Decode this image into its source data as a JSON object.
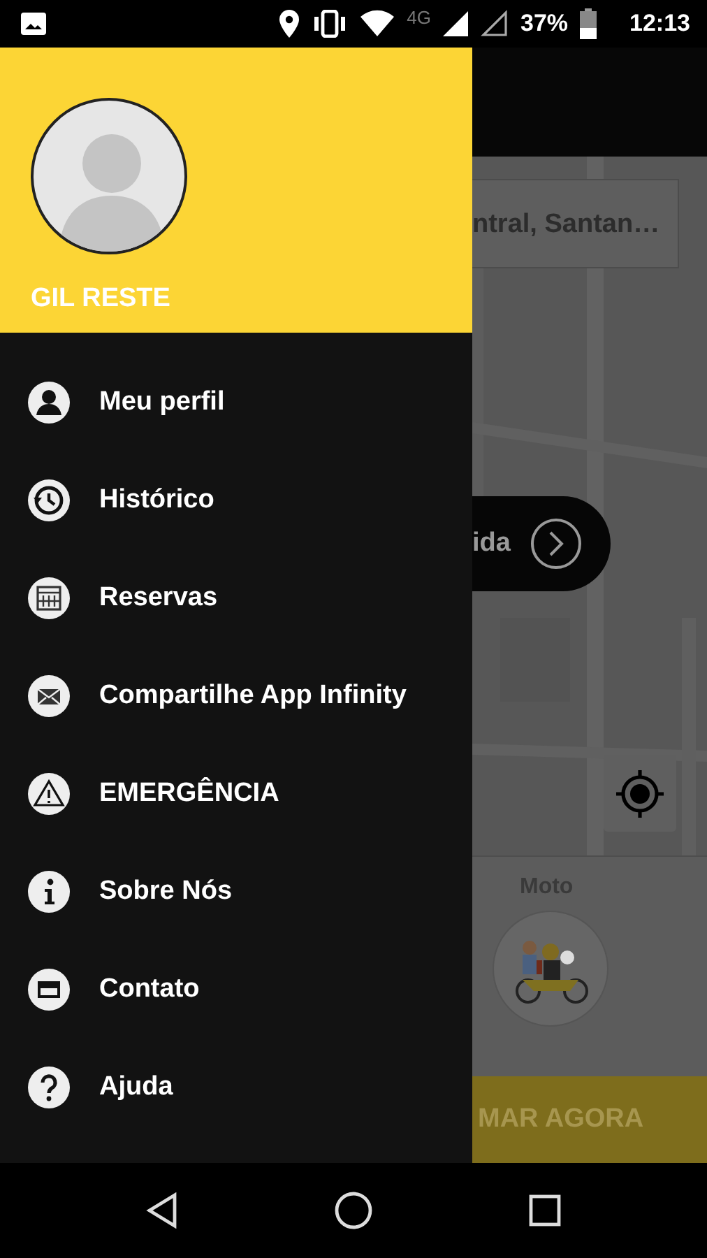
{
  "status_bar": {
    "network": "4G",
    "battery": "37%",
    "time": "12:13"
  },
  "drawer": {
    "user_name": "GIL RESTE",
    "items": [
      {
        "label": "Meu perfil"
      },
      {
        "label": "Histórico"
      },
      {
        "label": "Reservas"
      },
      {
        "label": "Compartilhe App Infinity"
      },
      {
        "label": "EMERGÊNCIA"
      },
      {
        "label": "Sobre Nós"
      },
      {
        "label": "Contato"
      },
      {
        "label": "Ajuda"
      }
    ]
  },
  "background_app": {
    "search_text": "ntral, Santan…",
    "ride_button": "ida",
    "vehicle_label": "Moto",
    "call_button": "MAR AGORA"
  }
}
